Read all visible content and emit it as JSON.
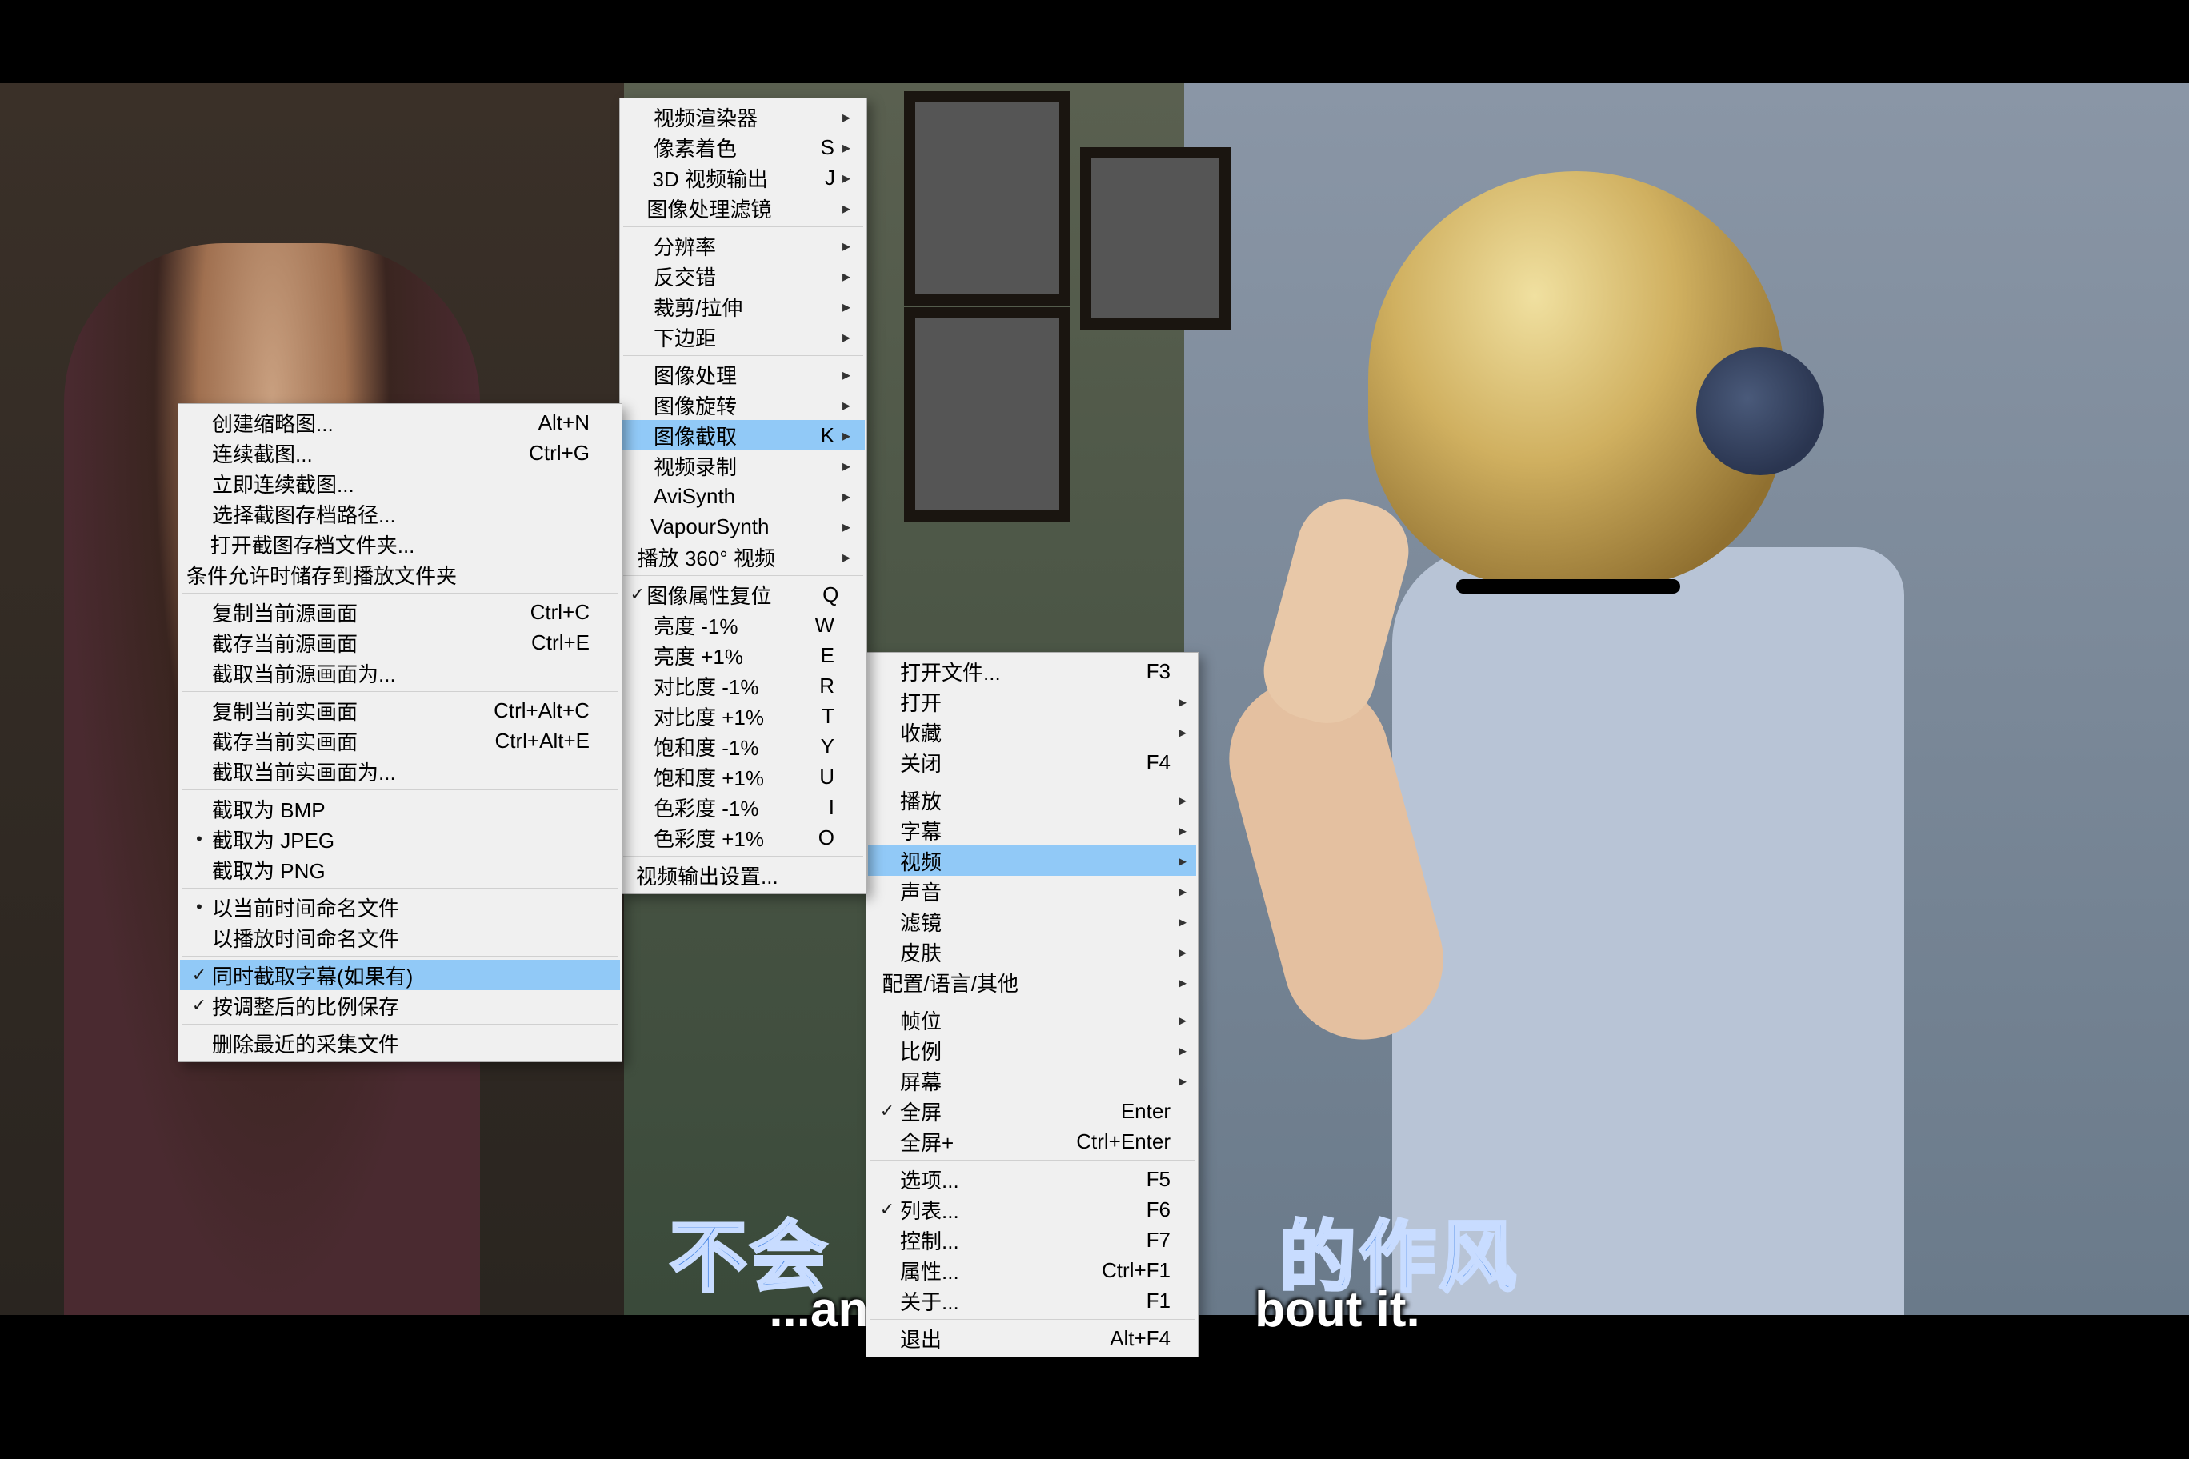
{
  "subtitle_cn_left": "不会",
  "subtitle_cn_right": "的作风",
  "subtitle_en_left": "...an",
  "subtitle_en_right": "bout it.",
  "menu1": [
    {
      "type": "item",
      "label": "打开文件...",
      "shortcut": "F3"
    },
    {
      "type": "item",
      "label": "打开",
      "arrow": true
    },
    {
      "type": "item",
      "label": "收藏",
      "arrow": true
    },
    {
      "type": "item",
      "label": "关闭",
      "shortcut": "F4"
    },
    {
      "type": "sep"
    },
    {
      "type": "item",
      "label": "播放",
      "arrow": true
    },
    {
      "type": "item",
      "label": "字幕",
      "arrow": true
    },
    {
      "type": "item",
      "label": "视频",
      "arrow": true,
      "hl": true
    },
    {
      "type": "item",
      "label": "声音",
      "arrow": true
    },
    {
      "type": "item",
      "label": "滤镜",
      "arrow": true
    },
    {
      "type": "item",
      "label": "皮肤",
      "arrow": true
    },
    {
      "type": "item",
      "label": "配置/语言/其他",
      "arrow": true
    },
    {
      "type": "sep"
    },
    {
      "type": "item",
      "label": "帧位",
      "arrow": true
    },
    {
      "type": "item",
      "label": "比例",
      "arrow": true
    },
    {
      "type": "item",
      "label": "屏幕",
      "arrow": true
    },
    {
      "type": "item",
      "label": "全屏",
      "shortcut": "Enter",
      "check": true
    },
    {
      "type": "item",
      "label": "全屏+",
      "shortcut": "Ctrl+Enter"
    },
    {
      "type": "sep"
    },
    {
      "type": "item",
      "label": "选项...",
      "shortcut": "F5"
    },
    {
      "type": "item",
      "label": "列表...",
      "shortcut": "F6",
      "check": true
    },
    {
      "type": "item",
      "label": "控制...",
      "shortcut": "F7"
    },
    {
      "type": "item",
      "label": "属性...",
      "shortcut": "Ctrl+F1"
    },
    {
      "type": "item",
      "label": "关于...",
      "shortcut": "F1"
    },
    {
      "type": "sep"
    },
    {
      "type": "item",
      "label": "退出",
      "shortcut": "Alt+F4"
    }
  ],
  "menu2": [
    {
      "type": "item",
      "label": "视频渲染器",
      "arrow": true
    },
    {
      "type": "item",
      "label": "像素着色",
      "shortcut": "S",
      "arrow": true
    },
    {
      "type": "item",
      "label": "3D 视频输出",
      "shortcut": "J",
      "arrow": true
    },
    {
      "type": "item",
      "label": "图像处理滤镜",
      "arrow": true
    },
    {
      "type": "sep"
    },
    {
      "type": "item",
      "label": "分辨率",
      "arrow": true
    },
    {
      "type": "item",
      "label": "反交错",
      "arrow": true
    },
    {
      "type": "item",
      "label": "裁剪/拉伸",
      "arrow": true
    },
    {
      "type": "item",
      "label": "下边距",
      "arrow": true
    },
    {
      "type": "sep"
    },
    {
      "type": "item",
      "label": "图像处理",
      "arrow": true
    },
    {
      "type": "item",
      "label": "图像旋转",
      "arrow": true
    },
    {
      "type": "item",
      "label": "图像截取",
      "shortcut": "K",
      "arrow": true,
      "hl": true
    },
    {
      "type": "item",
      "label": "视频录制",
      "arrow": true
    },
    {
      "type": "item",
      "label": "AviSynth",
      "arrow": true
    },
    {
      "type": "item",
      "label": "VapourSynth",
      "arrow": true
    },
    {
      "type": "item",
      "label": "播放 360° 视频",
      "arrow": true
    },
    {
      "type": "sep"
    },
    {
      "type": "item",
      "label": "图像属性复位",
      "shortcut": "Q",
      "check": true
    },
    {
      "type": "item",
      "label": "亮度 -1%",
      "shortcut": "W"
    },
    {
      "type": "item",
      "label": "亮度 +1%",
      "shortcut": "E"
    },
    {
      "type": "item",
      "label": "对比度 -1%",
      "shortcut": "R"
    },
    {
      "type": "item",
      "label": "对比度 +1%",
      "shortcut": "T"
    },
    {
      "type": "item",
      "label": "饱和度 -1%",
      "shortcut": "Y"
    },
    {
      "type": "item",
      "label": "饱和度 +1%",
      "shortcut": "U"
    },
    {
      "type": "item",
      "label": "色彩度 -1%",
      "shortcut": "I"
    },
    {
      "type": "item",
      "label": "色彩度 +1%",
      "shortcut": "O"
    },
    {
      "type": "sep"
    },
    {
      "type": "item",
      "label": "视频输出设置..."
    }
  ],
  "menu3": [
    {
      "type": "item",
      "label": "创建缩略图...",
      "shortcut": "Alt+N"
    },
    {
      "type": "item",
      "label": "连续截图...",
      "shortcut": "Ctrl+G"
    },
    {
      "type": "item",
      "label": "立即连续截图..."
    },
    {
      "type": "item",
      "label": "选择截图存档路径..."
    },
    {
      "type": "item",
      "label": "打开截图存档文件夹..."
    },
    {
      "type": "item",
      "label": "条件允许时储存到播放文件夹"
    },
    {
      "type": "sep"
    },
    {
      "type": "item",
      "label": "复制当前源画面",
      "shortcut": "Ctrl+C"
    },
    {
      "type": "item",
      "label": "截存当前源画面",
      "shortcut": "Ctrl+E"
    },
    {
      "type": "item",
      "label": "截取当前源画面为..."
    },
    {
      "type": "sep"
    },
    {
      "type": "item",
      "label": "复制当前实画面",
      "shortcut": "Ctrl+Alt+C"
    },
    {
      "type": "item",
      "label": "截存当前实画面",
      "shortcut": "Ctrl+Alt+E"
    },
    {
      "type": "item",
      "label": "截取当前实画面为..."
    },
    {
      "type": "sep"
    },
    {
      "type": "item",
      "label": "截取为 BMP"
    },
    {
      "type": "item",
      "label": "截取为 JPEG",
      "radio": true
    },
    {
      "type": "item",
      "label": "截取为 PNG"
    },
    {
      "type": "sep"
    },
    {
      "type": "item",
      "label": "以当前时间命名文件",
      "radio": true
    },
    {
      "type": "item",
      "label": "以播放时间命名文件"
    },
    {
      "type": "sep"
    },
    {
      "type": "item",
      "label": "同时截取字幕(如果有)",
      "check": true,
      "hl": true
    },
    {
      "type": "item",
      "label": "按调整后的比例保存",
      "check": true
    },
    {
      "type": "sep"
    },
    {
      "type": "item",
      "label": "删除最近的采集文件"
    }
  ]
}
